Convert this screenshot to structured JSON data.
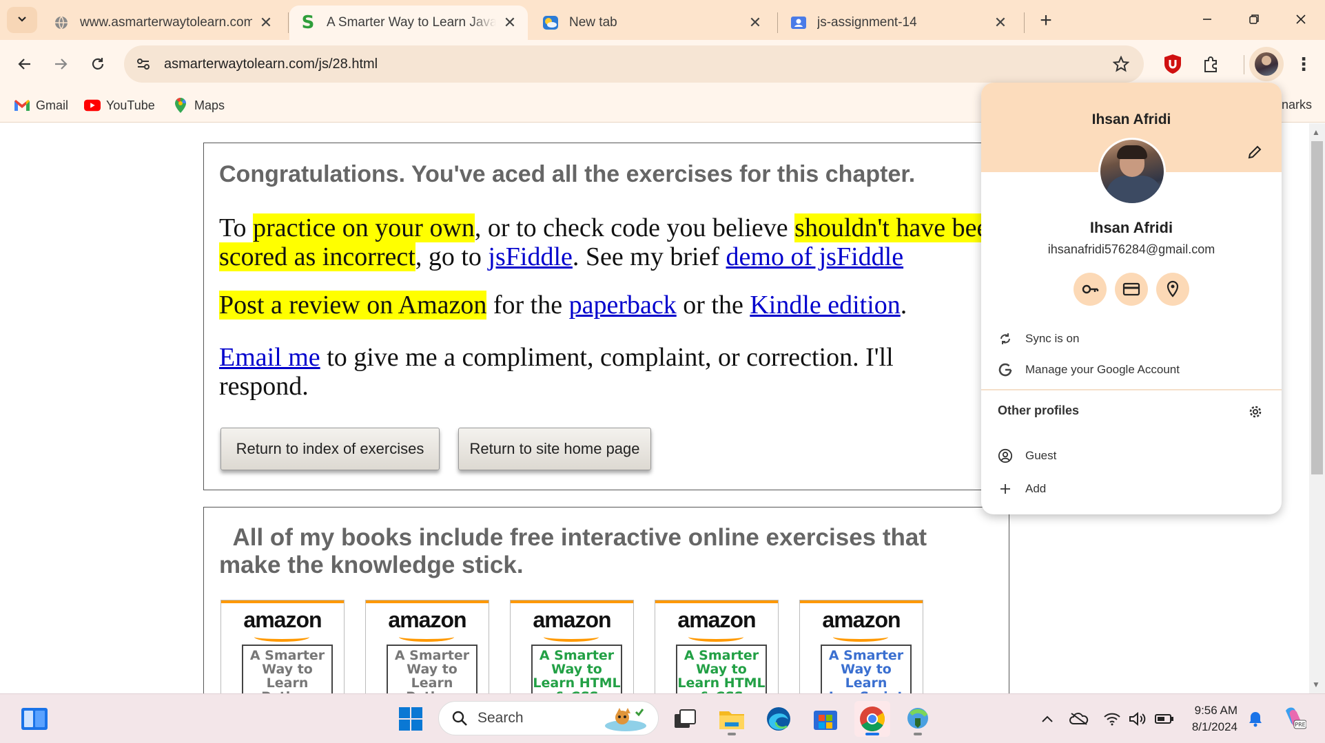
{
  "tabs": [
    {
      "title": "www.asmarterwaytolearn.com",
      "favicon": "globe-icon"
    },
    {
      "title": "A Smarter Way to Learn JavaScript",
      "favicon": "s-logo-icon",
      "active": true
    },
    {
      "title": "New tab",
      "favicon": "weather-icon"
    },
    {
      "title": "js-assignment-14",
      "favicon": "classroom-icon"
    }
  ],
  "toolbar": {
    "url": "asmarterwaytolearn.com/js/28.html"
  },
  "bookmarks": [
    {
      "label": "Gmail",
      "icon": "gmail-icon"
    },
    {
      "label": "YouTube",
      "icon": "youtube-icon"
    },
    {
      "label": "Maps",
      "icon": "maps-icon"
    }
  ],
  "bookmarks_tail": "narks",
  "page": {
    "congrats": "Congratulations. You've aced all the exercises for this chapter.",
    "p1": {
      "t1": "To ",
      "h1": "practice on your own",
      "t2": ", or to check code you believe ",
      "h2": "shouldn't have been scored as incorrect",
      "t3": ", go to ",
      "l1": "jsFiddle",
      "t4": ". See my brief ",
      "l2": "demo of jsFiddle"
    },
    "p2": {
      "h1": "Post a review on Amazon",
      "t1": " for the ",
      "l1": "paperback",
      "t2": " or the ",
      "l2": "Kindle edition",
      "t3": "."
    },
    "p3": {
      "l1": "Email me",
      "t1": " to give me a compliment, complaint, or correction. I'll respond."
    },
    "buttons": {
      "index": "Return to index of exercises",
      "home": "Return to site home page"
    },
    "books_heading": "All of my books include free interactive online exercises that make the knowledge stick.",
    "books": [
      {
        "logo": "amazon",
        "cover": "A Smarter Way to Learn Python",
        "color": "#777777"
      },
      {
        "logo": "amazon",
        "cover": "A Smarter Way to Learn Python",
        "color": "#777777"
      },
      {
        "logo": "amazon",
        "cover": "A Smarter Way to Learn HTML & CSS",
        "color": "#22a045"
      },
      {
        "logo": "amazon",
        "cover": "A Smarter Way to Learn HTML & CSS",
        "color": "#22a045"
      },
      {
        "logo": "amazon",
        "cover": "A Smarter Way to Learn JavaScript",
        "color": "#3a6fd0"
      }
    ]
  },
  "profile": {
    "name_header": "Ihsan Afridi",
    "name": "Ihsan Afridi",
    "email": "ihsanafridi576284@gmail.com",
    "sync": "Sync is on",
    "manage": "Manage your Google Account",
    "other_profiles": "Other profiles",
    "guest": "Guest",
    "add": "Add"
  },
  "taskbar": {
    "search": "Search",
    "time": "9:56 AM",
    "date": "8/1/2024"
  },
  "colors": {
    "accent": "#fde4cc",
    "highlight": "#ffff00",
    "link": "#0000cc"
  }
}
